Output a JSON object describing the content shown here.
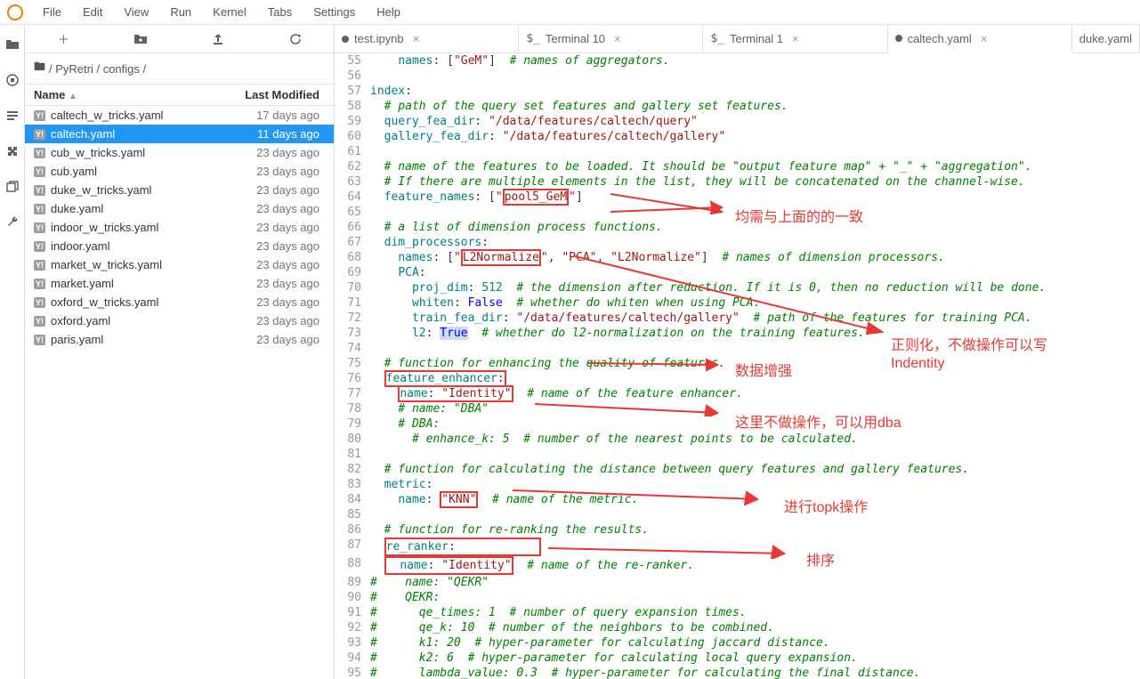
{
  "menu": {
    "file": "File",
    "edit": "Edit",
    "view": "View",
    "run": "Run",
    "kernel": "Kernel",
    "tabs": "Tabs",
    "settings": "Settings",
    "help": "Help"
  },
  "breadcrumb": {
    "folder": "🖿",
    "path": "/ PyRetri / configs /"
  },
  "fb_header": {
    "name": "Name",
    "modified": "Last Modified",
    "sort": "▲"
  },
  "files": [
    {
      "name": "caltech_w_tricks.yaml",
      "mod": "17 days ago"
    },
    {
      "name": "caltech.yaml",
      "mod": "11 days ago",
      "sel": true
    },
    {
      "name": "cub_w_tricks.yaml",
      "mod": "23 days ago"
    },
    {
      "name": "cub.yaml",
      "mod": "23 days ago"
    },
    {
      "name": "duke_w_tricks.yaml",
      "mod": "23 days ago"
    },
    {
      "name": "duke.yaml",
      "mod": "23 days ago"
    },
    {
      "name": "indoor_w_tricks.yaml",
      "mod": "23 days ago"
    },
    {
      "name": "indoor.yaml",
      "mod": "23 days ago"
    },
    {
      "name": "market_w_tricks.yaml",
      "mod": "23 days ago"
    },
    {
      "name": "market.yaml",
      "mod": "23 days ago"
    },
    {
      "name": "oxford_w_tricks.yaml",
      "mod": "23 days ago"
    },
    {
      "name": "oxford.yaml",
      "mod": "23 days ago"
    },
    {
      "name": "paris.yaml",
      "mod": "23 days ago"
    }
  ],
  "ytag": "Y!",
  "tabs": [
    {
      "label": "test.ipynb",
      "dot": true
    },
    {
      "label": "Terminal 10",
      "term": true
    },
    {
      "label": "Terminal 1",
      "term": true
    },
    {
      "label": "caltech.yaml",
      "dot": true,
      "active": true
    },
    {
      "label": "duke.yaml",
      "noclose": true
    }
  ],
  "anno": {
    "a1": "均需与上面的的一致",
    "a2": "正则化，不做操作可以写",
    "a2b": "Indentity",
    "a3": "数据增强",
    "a4": "这里不做操作，可以用dba",
    "a5": "进行topk操作",
    "a6": "排序"
  },
  "code": [
    {
      "n": 55,
      "html": "    <span class='t-key'>names</span><span class='t-p'>: [</span><span class='t-str'>\"GeM\"</span><span class='t-p'>]</span>  <span class='t-com'># names of aggregators.</span>"
    },
    {
      "n": 56,
      "html": ""
    },
    {
      "n": 57,
      "html": "<span class='t-key'>index</span><span class='t-p'>:</span>"
    },
    {
      "n": 58,
      "html": "  <span class='t-com'># path of the query set features and gallery set features.</span>"
    },
    {
      "n": 59,
      "html": "  <span class='t-key'>query_fea_dir</span><span class='t-p'>:</span> <span class='t-str'>\"/data/features/caltech/query\"</span>"
    },
    {
      "n": 60,
      "html": "  <span class='t-key'>gallery_fea_dir</span><span class='t-p'>:</span> <span class='t-str'>\"/data/features/caltech/gallery\"</span>"
    },
    {
      "n": 61,
      "html": ""
    },
    {
      "n": 62,
      "html": "  <span class='t-com'># name of the features to be loaded. It should be \"output feature map\" + \"_\" + \"aggregation\".</span>"
    },
    {
      "n": 63,
      "html": "  <span class='t-com'># If there are multiple elements in the list, they will be concatenated on the channel-wise.</span>"
    },
    {
      "n": 64,
      "html": "  <span class='t-key'>feature_names</span><span class='t-p'>: [</span><span class='t-str'>\"<span class='redbox'>pool5_GeM</span>\"</span><span class='t-p'>]</span>"
    },
    {
      "n": 65,
      "html": ""
    },
    {
      "n": 66,
      "html": "  <span class='t-com'># a list of dimension process functions.</span>"
    },
    {
      "n": 67,
      "html": "  <span class='t-key'>dim_processors</span><span class='t-p'>:</span>"
    },
    {
      "n": 68,
      "html": "    <span class='t-key'>names</span><span class='t-p'>: [</span><span class='t-str'>\"<span class='redbox'>L2Normalize</span>\"</span><span class='t-p'>, </span><span class='t-str'>\"PCA\"</span><span class='t-p'>, </span><span class='t-str'>\"L2Normalize\"</span><span class='t-p'>]</span>  <span class='t-com'># names of dimension processors.</span>"
    },
    {
      "n": 69,
      "html": "    <span class='t-key'>PCA</span><span class='t-p'>:</span>"
    },
    {
      "n": 70,
      "html": "      <span class='t-key'>proj_dim</span><span class='t-p'>:</span> <span class='t-num'>512</span>  <span class='t-com'># the dimension after reduction. If it is 0, then no reduction will be done.</span>"
    },
    {
      "n": 71,
      "html": "      <span class='t-key'>whiten</span><span class='t-p'>:</span> <span class='t-bool'>False</span>  <span class='t-com'># whether do whiten when using PCA.</span>"
    },
    {
      "n": 72,
      "html": "      <span class='t-key'>train_fea_dir</span><span class='t-p'>:</span> <span class='t-str'>\"/data/features/caltech/gallery\"</span>  <span class='t-com'># path of the features for training PCA.</span>"
    },
    {
      "n": 73,
      "html": "      <span class='t-key'>l2</span><span class='t-p'>:</span> <span style='background:#cde;'><span class='t-bool'>True</span></span>  <span class='t-com'># whether do l2-normalization on the training features.</span>"
    },
    {
      "n": 74,
      "html": ""
    },
    {
      "n": 75,
      "html": "  <span class='t-com'># function for enhancing the quality of features.</span>"
    },
    {
      "n": 76,
      "html": "  <span class='redbox'><span class='t-key'>feature_enhancer</span><span class='t-p'>:</span></span>"
    },
    {
      "n": 77,
      "html": "    <span class='redbox'><span class='t-key'>name</span><span class='t-p'>:</span> <span class='t-str'>\"Identity\"</span></span>  <span class='t-com'># name of the feature enhancer.</span>"
    },
    {
      "n": 78,
      "html": "    <span class='t-com'># name: \"DBA\"</span>"
    },
    {
      "n": 79,
      "html": "    <span class='t-com'># DBA:</span>"
    },
    {
      "n": 80,
      "html": "      <span class='t-com'># enhance_k: 5  # number of the nearest points to be calculated.</span>"
    },
    {
      "n": 81,
      "html": ""
    },
    {
      "n": 82,
      "html": "  <span class='t-com'># function for calculating the distance between query features and gallery features.</span>"
    },
    {
      "n": 83,
      "html": "  <span class='t-key'>metric</span><span class='t-p'>:</span>"
    },
    {
      "n": 84,
      "html": "    <span class='t-key'>name</span><span class='t-p'>:</span> <span class='redbox'><span class='t-str'>\"KNN\"</span></span>  <span class='t-com'># name of the metric.</span>"
    },
    {
      "n": 85,
      "html": ""
    },
    {
      "n": 86,
      "html": "  <span class='t-com'># function for re-ranking the results.</span>"
    },
    {
      "n": 87,
      "html": "  <span class='redbox' style='display:inline-block;'><span class='t-key'>re_ranker</span><span class='t-p'>:</span>            </span>"
    },
    {
      "n": 88,
      "html": "  <span class='redbox' style='display:inline-block;'>  <span class='t-key'>name</span><span class='t-p'>:</span> <span class='t-str'>\"Identity\"</span></span>  <span class='t-com'># name of the re-ranker.</span>"
    },
    {
      "n": 89,
      "html": "<span class='t-com'>#    name: \"QEKR\"</span>"
    },
    {
      "n": 90,
      "html": "<span class='t-com'>#    QEKR:</span>"
    },
    {
      "n": 91,
      "html": "<span class='t-com'>#      qe_times: 1  # number of query expansion times.</span>"
    },
    {
      "n": 92,
      "html": "<span class='t-com'>#      qe_k: 10  # number of the neighbors to be combined.</span>"
    },
    {
      "n": 93,
      "html": "<span class='t-com'>#      k1: 20  # hyper-parameter for calculating jaccard distance.</span>"
    },
    {
      "n": 94,
      "html": "<span class='t-com'>#      k2: 6  # hyper-parameter for calculating local query expansion.</span>"
    },
    {
      "n": 95,
      "html": "<span class='t-com'>#      lambda_value: 0.3  # hyper-parameter for calculating the final distance.</span>"
    }
  ]
}
